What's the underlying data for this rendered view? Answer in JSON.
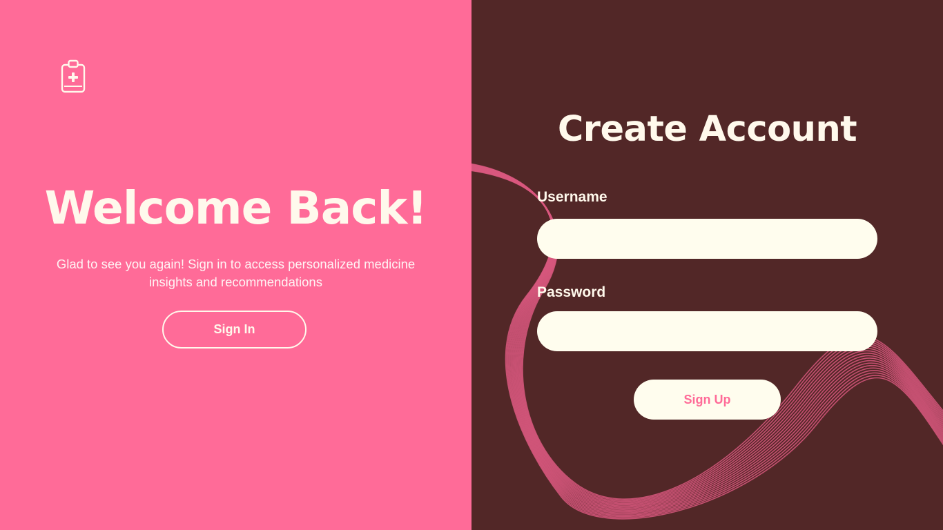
{
  "colors": {
    "left_background": "#FF6B98",
    "right_background": "#522727",
    "cream": "#FFF9EC",
    "field_background": "#FFFDEE",
    "wave_lines": "#D9587F"
  },
  "left_panel": {
    "logo_icon": "clipboard-medical-icon",
    "title": "Welcome Back!",
    "subtitle": "Glad to see you again! Sign in to access personalized medicine insights and recommendations",
    "sign_in_label": "Sign In"
  },
  "right_panel": {
    "title": "Create Account",
    "username": {
      "label": "Username",
      "value": "",
      "placeholder": ""
    },
    "password": {
      "label": "Password",
      "value": "",
      "placeholder": ""
    },
    "sign_up_label": "Sign Up"
  }
}
